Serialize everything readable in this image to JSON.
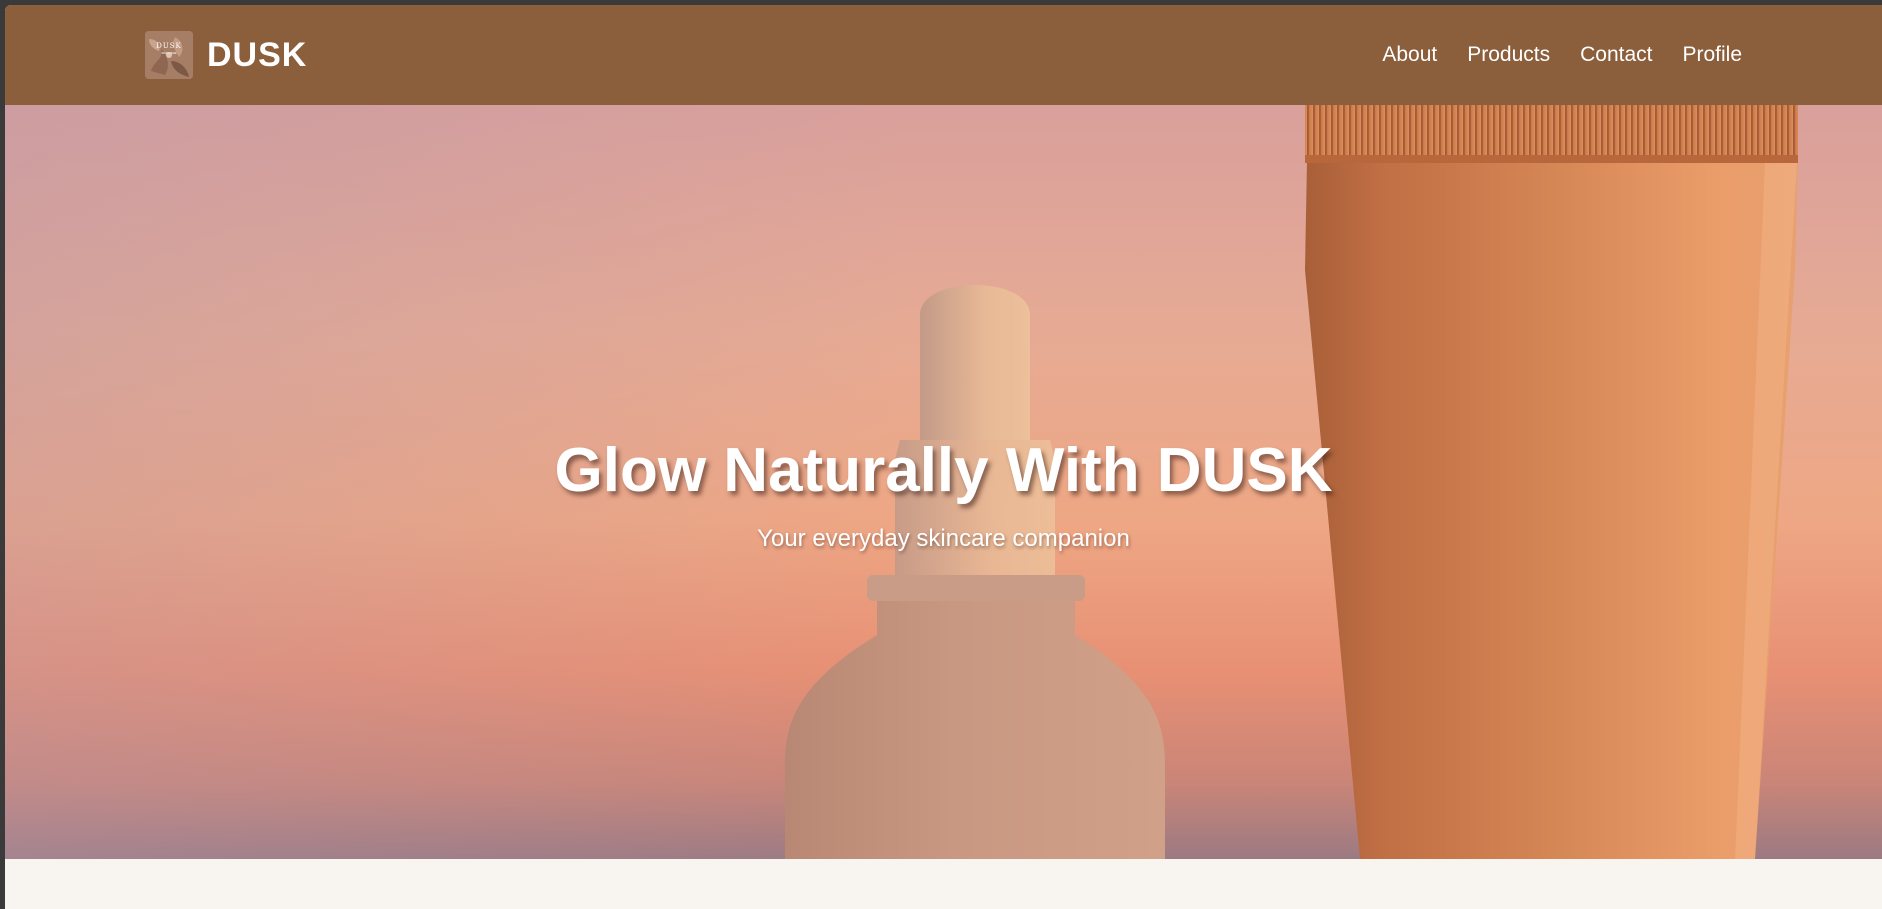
{
  "brand": {
    "name": "DUSK",
    "logo_text": "DUSK",
    "logo_subtext": "SKINCARE"
  },
  "nav": {
    "items": [
      {
        "label": "About"
      },
      {
        "label": "Products"
      },
      {
        "label": "Contact"
      },
      {
        "label": "Profile"
      }
    ]
  },
  "hero": {
    "title": "Glow Naturally With DUSK",
    "subtitle": "Your everyday skincare companion"
  },
  "colors": {
    "navbar": "#8b5e3c",
    "page_background": "#f8f5f0",
    "hero_top": "#d9a09c",
    "hero_bottom": "#9c7a82",
    "tube": "#c8784c",
    "bottle": "#c99882"
  },
  "icons": {
    "logo": "floral-logo-icon"
  }
}
